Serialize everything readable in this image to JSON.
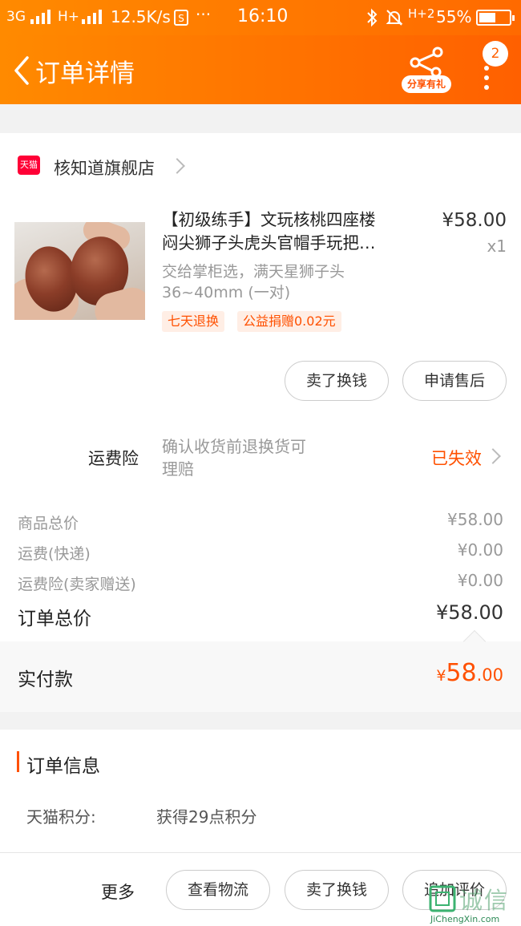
{
  "status_bar": {
    "network": "3G",
    "network2": "H+",
    "speed": "12.5K/s",
    "more": "···",
    "time": "16:10",
    "network3": "H+2",
    "battery": "55%",
    "battery_level": 0.55
  },
  "header": {
    "title": "订单详情",
    "share_label": "分享有礼",
    "message_count": "2"
  },
  "shop": {
    "badge": "天猫",
    "name": "核知道旗舰店"
  },
  "product": {
    "title_line1": "【初级练手】文玩核桃四座楼",
    "title_line2": "闷尖狮子头虎头官帽手玩把…",
    "price": "¥58.00",
    "quantity": "x1",
    "sku_line1": "交给掌柜选，满天星狮子头",
    "sku_line2": "36~40mm (一对)",
    "tags": [
      "七天退换",
      "公益捐赠0.02元"
    ]
  },
  "item_actions": [
    "卖了换钱",
    "申请售后"
  ],
  "insurance": {
    "label": "运费险",
    "desc_line1": "确认收货前退换货可",
    "desc_line2": "理赔",
    "status": "已失效"
  },
  "summary": {
    "rows": [
      {
        "label": "商品总价",
        "value": "¥58.00"
      },
      {
        "label": "运费(快递)",
        "value": "¥0.00"
      },
      {
        "label": "运费险(卖家赠送)",
        "value": "¥0.00"
      }
    ],
    "total_label": "订单总价",
    "total_value": "¥58.00",
    "paid_label": "实付款",
    "paid_currency": "¥",
    "paid_int": "58",
    "paid_dec": ".00"
  },
  "order_info": {
    "section_title": "订单信息",
    "points_label": "天猫积分:",
    "points_value": "获得29点积分"
  },
  "bottom_bar": {
    "more": "更多",
    "buttons": [
      "查看物流",
      "卖了换钱",
      "追加评价"
    ]
  },
  "watermark": {
    "text": "诚信",
    "url": "JiChengXin.com"
  },
  "colors": {
    "accent": "#ff5000",
    "header_gradient_start": "#ff8a00",
    "header_gradient_end": "#ff6000",
    "tmall_red": "#ff0036"
  }
}
